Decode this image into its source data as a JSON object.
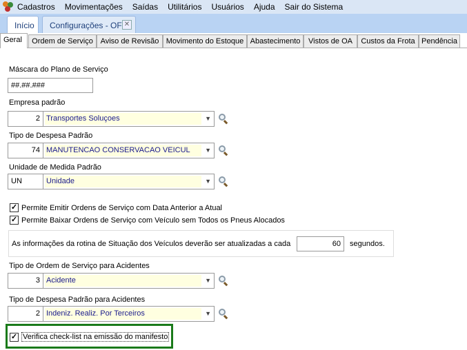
{
  "menu": {
    "items": [
      "Cadastros",
      "Movimentações",
      "Saídas",
      "Utilitários",
      "Usuários",
      "Ajuda",
      "Sair do Sistema"
    ]
  },
  "doc_tabs": {
    "inicio": "Início",
    "config": "Configurações - OFI"
  },
  "sub_tabs": [
    "Geral",
    "Ordem de Serviço",
    "Aviso de Revisão",
    "Movimento do Estoque",
    "Abastecimento",
    "Vistos de OA",
    "Custos da Frota",
    "Pendência"
  ],
  "form": {
    "mascara_label": "Máscara do Plano de Serviço",
    "mascara_value": "##.##.###",
    "empresa": {
      "label": "Empresa padrão",
      "code": "2",
      "desc": "Transportes Soluçoes"
    },
    "despesa": {
      "label": "Tipo de Despesa Padrão",
      "code": "74",
      "desc": "MANUTENCAO CONSERVACAO VEICUL"
    },
    "unidade": {
      "label": "Unidade de Medida Padrão",
      "code": "UN",
      "desc": "Unidade"
    },
    "chk1": "Permite Emitir Ordens de Serviço com Data Anterior a Atual",
    "chk2": "Permite Baixar Ordens de Serviço com Veículo sem Todos os Pneus Alocados",
    "refresh_text": "As informações da rotina de Situação dos Veículos deverão ser atualizadas a cada",
    "refresh_value": "60",
    "refresh_unit": "segundos.",
    "ordem_acid": {
      "label": "Tipo de Ordem de Serviço para Acidentes",
      "code": "3",
      "desc": "Acidente"
    },
    "despesa_acid": {
      "label": "Tipo de Despesa Padrão para Acidentes",
      "code": "2",
      "desc": "Indeniz. Realiz. Por Terceiros"
    },
    "chk3": "Verifica check-list na emissão do manifesto"
  },
  "colors": {
    "highlight": "#1a7a1a",
    "field_bg": "#ffffe0"
  }
}
